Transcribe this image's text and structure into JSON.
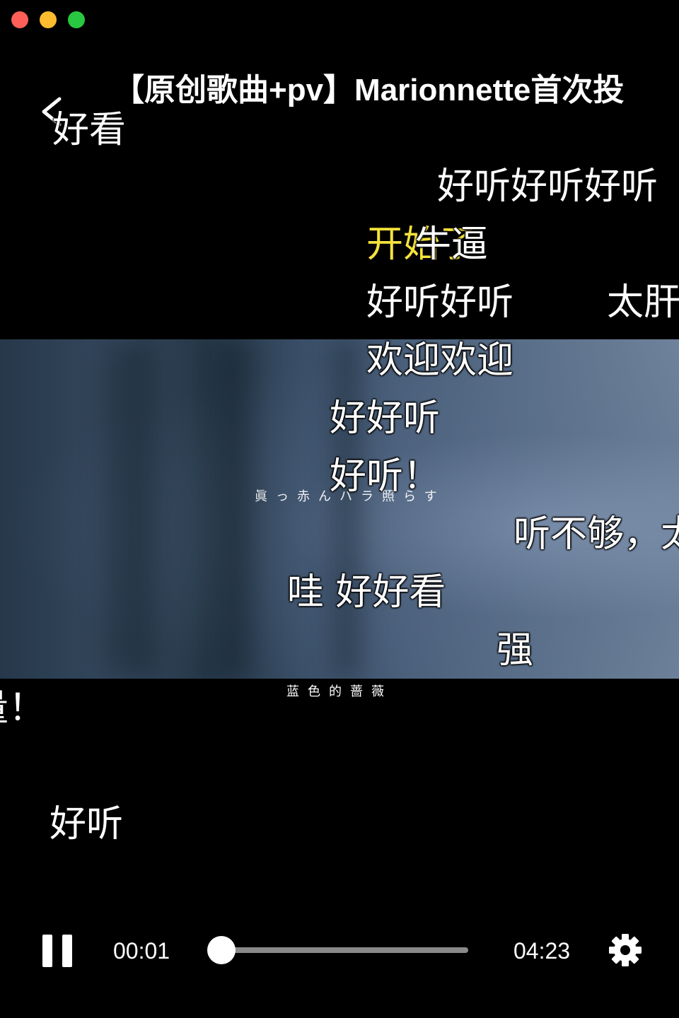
{
  "window": {
    "controls": [
      "close",
      "minimize",
      "zoom"
    ]
  },
  "header": {
    "title": "【原创歌曲+pv】Marionnette首次投",
    "back_icon": "chevron-left-icon"
  },
  "video": {
    "lyric_main": "眞っ赤んハラ照らす",
    "lyric_sub": "蓝色的蔷薇"
  },
  "danmaku": [
    {
      "id": "d1",
      "text": "好看",
      "color": "#ffffff"
    },
    {
      "id": "d2",
      "text": "好听好听好听",
      "color": "#ffffff"
    },
    {
      "id": "d3",
      "text": "开始了",
      "color": "#f5e23b"
    },
    {
      "id": "d4",
      "text": "牛逼",
      "color": "#ffffff"
    },
    {
      "id": "d5",
      "text": "好听好听",
      "color": "#ffffff"
    },
    {
      "id": "d6",
      "text": "太肝",
      "color": "#ffffff"
    },
    {
      "id": "d7",
      "text": "欢迎欢迎",
      "color": "#ffffff"
    },
    {
      "id": "d8",
      "text": "好好听",
      "color": "#ffffff"
    },
    {
      "id": "d9",
      "text": "好听！",
      "color": "#ffffff"
    },
    {
      "id": "d10",
      "text": "听不够，太",
      "color": "#ffffff"
    },
    {
      "id": "d11",
      "text": "哇 好好看",
      "color": "#ffffff"
    },
    {
      "id": "d12",
      "text": "强",
      "color": "#ffffff"
    },
    {
      "id": "d13",
      "text": "量！",
      "color": "#ffffff"
    },
    {
      "id": "d14",
      "text": "好听",
      "color": "#ffffff"
    }
  ],
  "player": {
    "state": "playing",
    "pause_icon": "pause-icon",
    "current_time": "00:01",
    "duration": "04:23",
    "progress_fraction": 0.004,
    "settings_icon": "gear-icon"
  }
}
